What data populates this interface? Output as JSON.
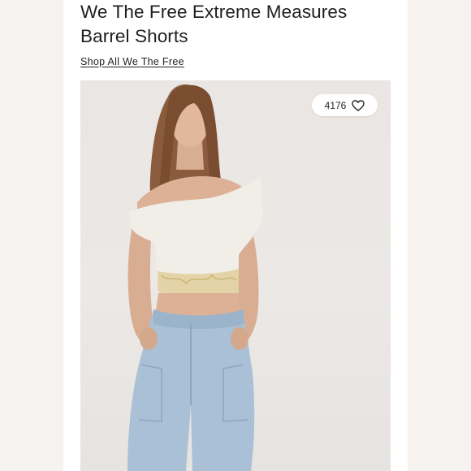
{
  "product": {
    "title": "We The Free Extreme Measures Barrel Shorts",
    "shop_link_label": "Shop All We The Free",
    "like_count": "4176"
  },
  "icons": {
    "like": "heart-outline-icon"
  },
  "colors": {
    "page_background": "#f6f2ef",
    "card_background": "#ffffff",
    "text": "#1f1f1f",
    "photo_background": "#e9e6e3",
    "denim": "#a9c0d6",
    "top_fabric": "#f1eee7",
    "lace_trim": "#e3d3a6"
  }
}
